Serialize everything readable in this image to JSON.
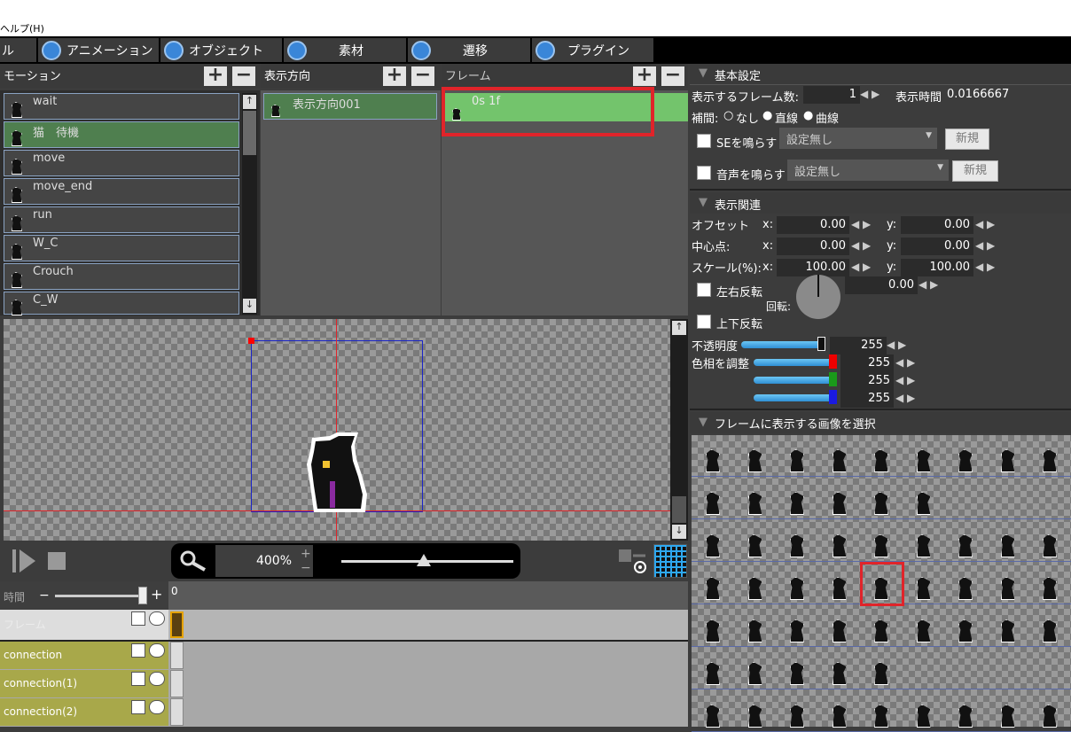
{
  "menu": {
    "help": "ヘルプ(H)"
  },
  "tabs": [
    {
      "label": "ル"
    },
    {
      "label": "アニメーション",
      "icon": "animation-icon"
    },
    {
      "label": "オブジェクト",
      "icon": "object-icon"
    },
    {
      "label": "素材",
      "icon": "material-icon"
    },
    {
      "label": "遷移",
      "icon": "transition-icon"
    },
    {
      "label": "プラグイン",
      "icon": "plugin-icon"
    }
  ],
  "motion_panel": {
    "title": "モーション",
    "items": [
      "wait",
      "猫　待機",
      "move",
      "move_end",
      "run",
      "W_C",
      "Crouch",
      "C_W"
    ]
  },
  "direction_panel": {
    "title": "表示方向",
    "items": [
      "表示方向001"
    ]
  },
  "frame_panel": {
    "title": "フレーム",
    "items": [
      "0s 1f"
    ]
  },
  "basic": {
    "title": "基本設定",
    "frame_count_label": "表示するフレーム数:",
    "frame_count": "1",
    "display_time_label": "表示時間",
    "display_time": "0.0166667",
    "interp_label": "補間:",
    "interp_none": "なし",
    "interp_linear": "直線",
    "interp_curve": "曲線",
    "se_label": "SEを鳴らす",
    "se_value": "設定無し",
    "se_new": "新規",
    "voice_label": "音声を鳴らす",
    "voice_value": "設定無し",
    "voice_new": "新規"
  },
  "display": {
    "title": "表示関連",
    "offset_label": "オフセット",
    "center_label": "中心点:",
    "scale_label": "スケール(%):",
    "x": "x:",
    "y": "y:",
    "offset_x": "0.00",
    "offset_y": "0.00",
    "center_x": "0.00",
    "center_y": "0.00",
    "scale_x": "100.00",
    "scale_y": "100.00",
    "flip_h": "左右反転",
    "rotation_label": "回転:",
    "rotation": "0.00",
    "flip_v": "上下反転",
    "opacity_label": "不透明度",
    "opacity": "255",
    "hue_label": "色相を調整",
    "hue_r": "255",
    "hue_g": "255",
    "hue_b": "255"
  },
  "image_select": {
    "title": "フレームに表示する画像を選択"
  },
  "preview": {
    "zoom": "400%"
  },
  "timeline": {
    "time_label": "時間",
    "tick0": "0",
    "rows": [
      {
        "label": "フレーム"
      },
      {
        "label": "connection"
      },
      {
        "label": "connection(1)"
      },
      {
        "label": "connection(2)"
      }
    ]
  },
  "colors": {
    "selected_green": "#73c46c",
    "highlight_red": "#e0242a",
    "list_border": "#8aa2c2"
  }
}
